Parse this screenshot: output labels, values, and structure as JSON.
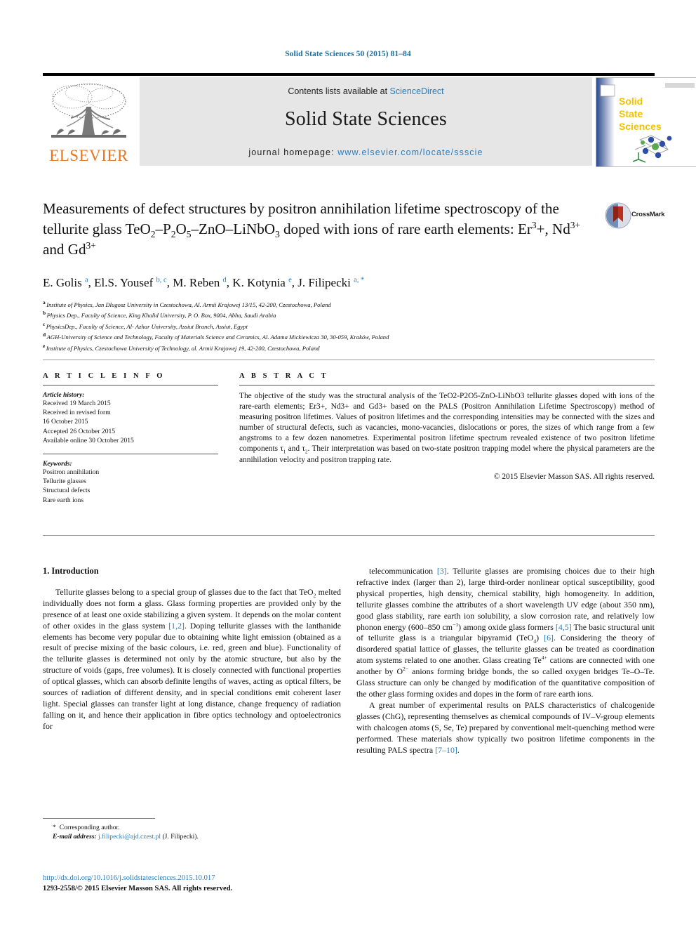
{
  "running_head": "Solid State Sciences 50 (2015) 81–84",
  "masthead": {
    "contents_prefix": "Contents lists available at ",
    "contents_link": "ScienceDirect",
    "journal_title": "Solid State Sciences",
    "homepage_prefix": "journal homepage: ",
    "homepage_url": "www.elsevier.com/locate/ssscie",
    "publisher": "ELSEVIER",
    "cover_title_lines": [
      "Solid",
      "State",
      "Sciences"
    ],
    "accent_link_color": "#2b7bb9",
    "band_color": "#e6e6e6",
    "elsevier_orange": "#E87722"
  },
  "crossmark": {
    "label": "CrossMark"
  },
  "article": {
    "title_html": "Measurements of defect structures by positron annihilation lifetime spectroscopy of the tellurite glass TeO<sub>2</sub>–P<sub>2</sub>O<sub>5</sub>–ZnO–LiNbO<sub>3</sub> doped with ions of rare earth elements: Er<sup>3</sup>+, Nd<sup>3+</sup> and Gd<sup>3+</sup>",
    "authors_html": "E. Golis <sup>a</sup>, El.S. Yousef <sup>b, c</sup>, M. Reben <sup>d</sup>, K. Kotynia <sup>e</sup>, J. Filipecki <sup>a, *</sup>",
    "affiliations": [
      {
        "marker": "a",
        "text": "Institute of Physics, Jan Dlugosz University in Czestochowa, Al. Armii Krajowej 13/15, 42-200, Czestochowa, Poland"
      },
      {
        "marker": "b",
        "text": "Physics Dep., Faculty of Science, King Khalid University, P. O. Box, 9004, Abha, Saudi Arabia"
      },
      {
        "marker": "c",
        "text": "PhysicsDep., Faculty of Science, Al- Azhar University, Assiut Branch, Assiut, Egypt"
      },
      {
        "marker": "d",
        "text": "AGH-University of Science and Technology, Faculty of Materials Science and Ceramics, Al. Adama Mickiewicza 30, 30-059, Kraków, Poland"
      },
      {
        "marker": "e",
        "text": "Institute of Physics, Czestochowa University of Technology, al. Armii Krajowej 19, 42-200, Czestochowa, Poland"
      }
    ]
  },
  "info": {
    "heading": "A R T I C L E   I N F O",
    "history_label": "Article history:",
    "history": [
      "Received 19 March 2015",
      "Received in revised form",
      "16 October 2015",
      "Accepted 26 October 2015",
      "Available online 30 October 2015"
    ],
    "keywords_label": "Keywords:",
    "keywords": [
      "Positron annihilation",
      "Tellurite glasses",
      "Structural defects",
      "Rare earth ions"
    ]
  },
  "abstract": {
    "heading": "A B S T R A C T",
    "body_html": "The objective of the study was the structural analysis of the TeO2-P2O5-ZnO-LiNbO3 tellurite glasses doped with ions of the rare-earth elements; Er3+, Nd3+ and Gd3+ based on the PALS (Positron Annihilation Lifetime Spectroscopy) method of measuring positron lifetimes. Values of positron lifetimes and the corresponding intensities may be connected with the sizes and number of structural defects, such as vacancies, mono-vacancies, dislocations or pores, the sizes of which range from a few angstroms to a few dozen nanometres. Experimental positron lifetime spectrum revealed existence of two positron lifetime components τ<sub>1</sub> and τ<sub>2</sub>. Their interpretation was based on two-state positron trapping model where the physical parameters are the annihilation velocity and positron trapping rate.",
    "copyright": "© 2015 Elsevier Masson SAS. All rights reserved."
  },
  "body": {
    "section_heading": "1. Introduction",
    "left_paragraph_html": "Tellurite glasses belong to a special group of glasses due to the fact that TeO<sub>2</sub> melted individually does not form a glass. Glass forming properties are provided only by the presence of at least one oxide stabilizing a given system. It depends on the molar content of other oxides in the glass system <span class=\"ref\">[1,2]</span>. Doping tellurite glasses with the lanthanide elements has become very popular due to obtaining white light emission (obtained as a result of precise mixing of the basic colours, i.e. red, green and blue). Functionality of the tellurite glasses is determined not only by the atomic structure, but also by the structure of voids (gaps, free volumes). It is closely connected with functional properties of optical glasses, which can absorb definite lengths of waves, acting as optical filters, be sources of radiation of different density, and in special conditions emit coherent laser light. Special glasses can transfer light at long distance, change frequency of radiation falling on it, and hence their application in fibre optics technology and optoelectronics for",
    "right_paragraph_1_html": "telecommunication <span class=\"ref\">[3]</span>. Tellurite glasses are promising choices due to their high refractive index (larger than 2), large third-order nonlinear optical susceptibility, good physical properties, high density, chemical stability, high homogeneity. In addition, tellurite glasses combine the attributes of a short wavelength UV edge (about 350 nm), good glass stability, rare earth ion solubility, a slow corrosion rate, and relatively low phonon energy (600–850 cm<sup>−1</sup>) among oxide glass formers <span class=\"ref\">[4,5]</span> The basic structural unit of tellurite glass is a triangular bipyramid (TeO<sub>4</sub>) <span class=\"ref\">[6]</span>. Considering the theory of disordered spatial lattice of glasses, the tellurite glasses can be treated as coordination atom systems related to one another. Glass creating Te<sup>4+</sup> cations are connected with one another by O<sup>2−</sup> anions forming bridge bonds, the so called oxygen bridges Te–O–Te. Glass structure can only be changed by modification of the quantitative composition of the other glass forming oxides and dopes in the form of rare earth ions.",
    "right_paragraph_2_html": "A great number of experimental results on PALS characteristics of chalcogenide glasses (ChG), representing themselves as chemical compounds of IV–V-group elements with chalcogen atoms (S, Se, Te) prepared by conventional melt-quenching method were performed. These materials show typically two positron lifetime components in the resulting PALS spectra <span class=\"ref\">[7–10]</span>."
  },
  "footnote": {
    "corresponding": "Corresponding author.",
    "email_label": "E-mail address:",
    "email": "j.filipecki@ajd.czest.pl",
    "email_owner": "(J. Filipecki)."
  },
  "footer": {
    "doi": "http://dx.doi.org/10.1016/j.solidstatesciences.2015.10.017",
    "issn": "1293-2558/© 2015 Elsevier Masson SAS. All rights reserved."
  }
}
